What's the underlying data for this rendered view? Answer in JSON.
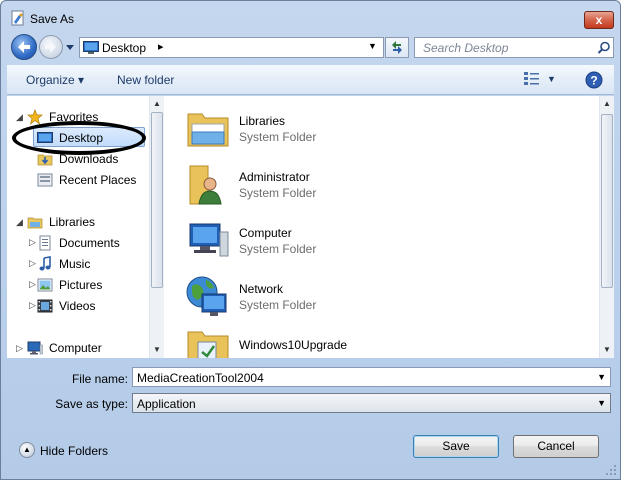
{
  "window": {
    "title": "Save As",
    "close_glyph": "x"
  },
  "address_bar": {
    "location": "Desktop",
    "separator": "▸"
  },
  "search": {
    "placeholder": "Search Desktop"
  },
  "toolbar": {
    "organize_label": "Organize ▾",
    "new_folder_label": "New folder"
  },
  "nav_pane": {
    "favorites": {
      "label": "Favorites",
      "items": [
        "Desktop",
        "Downloads",
        "Recent Places"
      ]
    },
    "libraries": {
      "label": "Libraries",
      "items": [
        "Documents",
        "Music",
        "Pictures",
        "Videos"
      ]
    },
    "computer": {
      "label": "Computer"
    },
    "selected": "Desktop"
  },
  "files": [
    {
      "name": "Libraries",
      "type": "System Folder",
      "icon": "libraries-folder-icon"
    },
    {
      "name": "Administrator",
      "type": "System Folder",
      "icon": "user-folder-icon"
    },
    {
      "name": "Computer",
      "type": "System Folder",
      "icon": "computer-icon"
    },
    {
      "name": "Network",
      "type": "System Folder",
      "icon": "network-icon"
    },
    {
      "name": "Windows10Upgrade",
      "type": "",
      "icon": "folder-icon"
    }
  ],
  "form": {
    "file_name_label": "File name:",
    "file_name_value": "MediaCreationTool2004",
    "save_type_label": "Save as type:",
    "save_type_value": "Application"
  },
  "buttons": {
    "hide_folders": "Hide Folders",
    "save": "Save",
    "cancel": "Cancel"
  },
  "colors": {
    "selection": "#c1dcfc",
    "frame": "#bcd2ed",
    "annotation": "#000000"
  }
}
